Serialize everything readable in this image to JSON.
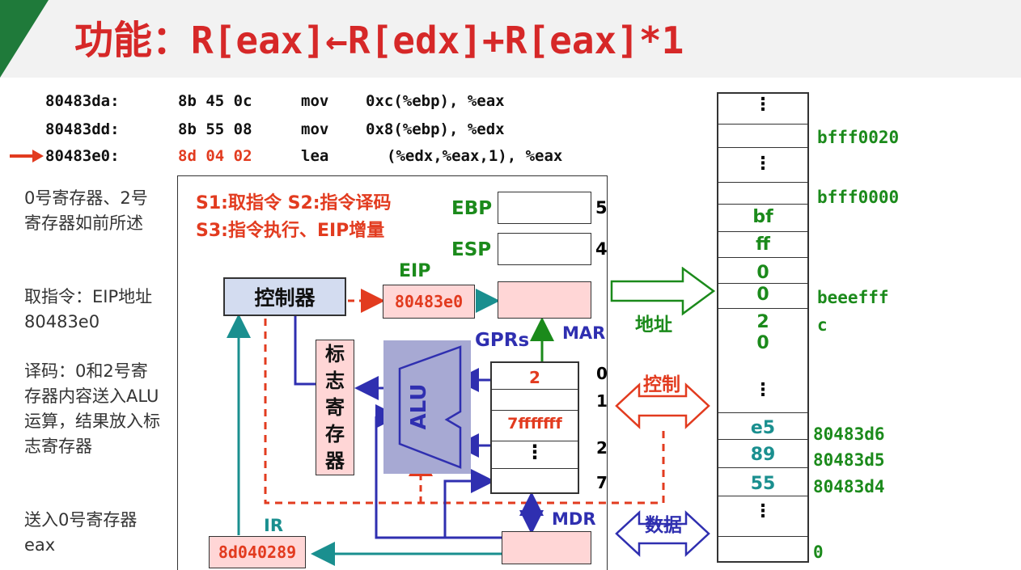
{
  "title": {
    "prefix": "功能：",
    "expr": "R[eax]←R[edx]+R[eax]*1"
  },
  "asm": [
    {
      "addr": "80483da:",
      "bytes": "8b 45 0c",
      "op": "mov",
      "args": "0xc(%ebp), %eax"
    },
    {
      "addr": "80483dd:",
      "bytes": "8b 55 08",
      "op": "mov",
      "args": "0x8(%ebp), %edx"
    },
    {
      "addr": "80483e0:",
      "bytes": "8d 04 02",
      "op": "lea",
      "args": "(%edx,%eax,1), %eax"
    }
  ],
  "notes": [
    "0号寄存器、2号寄存器如前所述",
    "取指令：EIP地址80483e0",
    "译码：0和2号寄存器内容送入ALU运算，结果放入标志寄存器",
    "送入0号寄存器eax"
  ],
  "stages": {
    "line1": "S1:取指令  S2:指令译码",
    "line2": "S3:指令执行、EIP增量"
  },
  "cpu": {
    "ebp": "EBP",
    "esp": "ESP",
    "ebp_num": "5",
    "esp_num": "4",
    "eip_label": "EIP",
    "eip_value": "80483e0",
    "controller": "控制器",
    "mar": "MAR",
    "mdr": "MDR",
    "gprs": "GPRs",
    "alu": "ALU",
    "flags": [
      "标",
      "志",
      "寄",
      "存",
      "器"
    ],
    "ir_label": "IR",
    "ir_value": "8d040289",
    "gpr_values": {
      "r0": "2",
      "r1": "",
      "r2": "7fffffff",
      "dots": "⋮"
    },
    "gpr_nums": [
      "0",
      "1",
      "2",
      "7"
    ]
  },
  "bus": {
    "address": "地址",
    "control": "控制",
    "data": "数据"
  },
  "memory": {
    "cells": [
      "⋮",
      "",
      "⋮",
      "",
      "bf",
      "ff",
      "0",
      "0",
      "2",
      "0",
      "⋮",
      "e5",
      "89",
      "55",
      "⋮",
      ""
    ],
    "addresses": {
      "a1": "bfff0020",
      "a2": "bfff0000",
      "a3": "beeefff",
      "a4": "c",
      "a5": "80483d6",
      "a6": "80483d5",
      "a7": "80483d4",
      "a8": "0"
    }
  },
  "colors": {
    "accent_red": "#d62828",
    "green": "#1b8a1b",
    "blue": "#2f2fb0",
    "teal": "#1a8f8f",
    "header_green": "#1f7a3a"
  }
}
